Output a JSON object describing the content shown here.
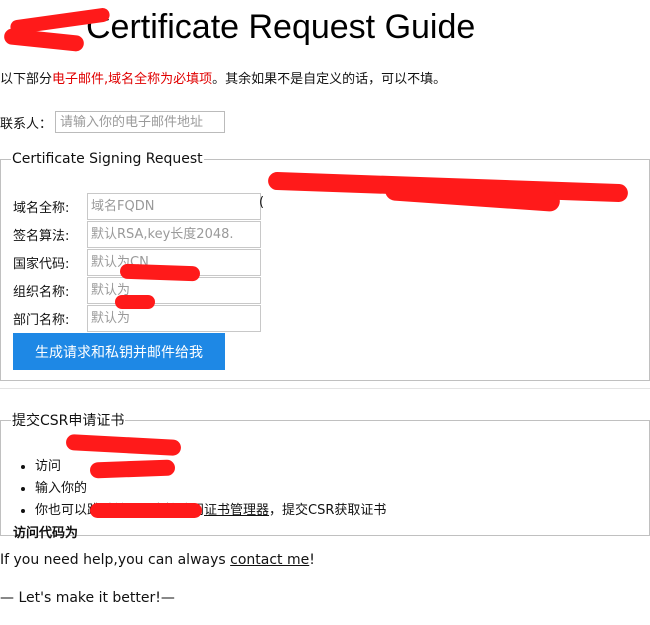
{
  "header": {
    "title_prefix": "",
    "title": "Certificate Request Guide"
  },
  "intro": {
    "lead": "以下部分",
    "required_text": "电子邮件,域名全称为必填项",
    "rest": "。其余如果不是自定义的话，可以不填。"
  },
  "contact": {
    "label": "联系人：",
    "email_placeholder": "请输入你的电子邮件地址"
  },
  "csr_section": {
    "legend": "Certificate Signing Request",
    "fqdn_suffix": "(",
    "fields": [
      {
        "label": "域名全称:",
        "placeholder": "域名FQDN"
      },
      {
        "label": "签名算法:",
        "placeholder": "默认RSA,key长度2048."
      },
      {
        "label": "国家代码:",
        "placeholder": "默认为CN"
      },
      {
        "label": "组织名称:",
        "placeholder": "默认为"
      },
      {
        "label": "部门名称:",
        "placeholder": "默认为"
      }
    ],
    "generate_button": "生成请求和私钥并邮件给我"
  },
  "submit_section": {
    "legend": "提交CSR申请证书",
    "step1_prefix": "访问",
    "step2_prefix": "输入你的",
    "step3_prefix": "你也可以跳过前面，直接访问",
    "step3_link": "证书管理器",
    "step3_suffix": "，提交CSR获取证书",
    "access_code_label": "访问代码为"
  },
  "footer": {
    "help_text": "If you need help,you can always ",
    "contact_link": "contact me",
    "help_end": "!",
    "slogan": "— Let's make it better!—"
  },
  "colors": {
    "accent": "#1e88e5",
    "required_text": "#e00000",
    "redaction": "#ff1a1a"
  }
}
